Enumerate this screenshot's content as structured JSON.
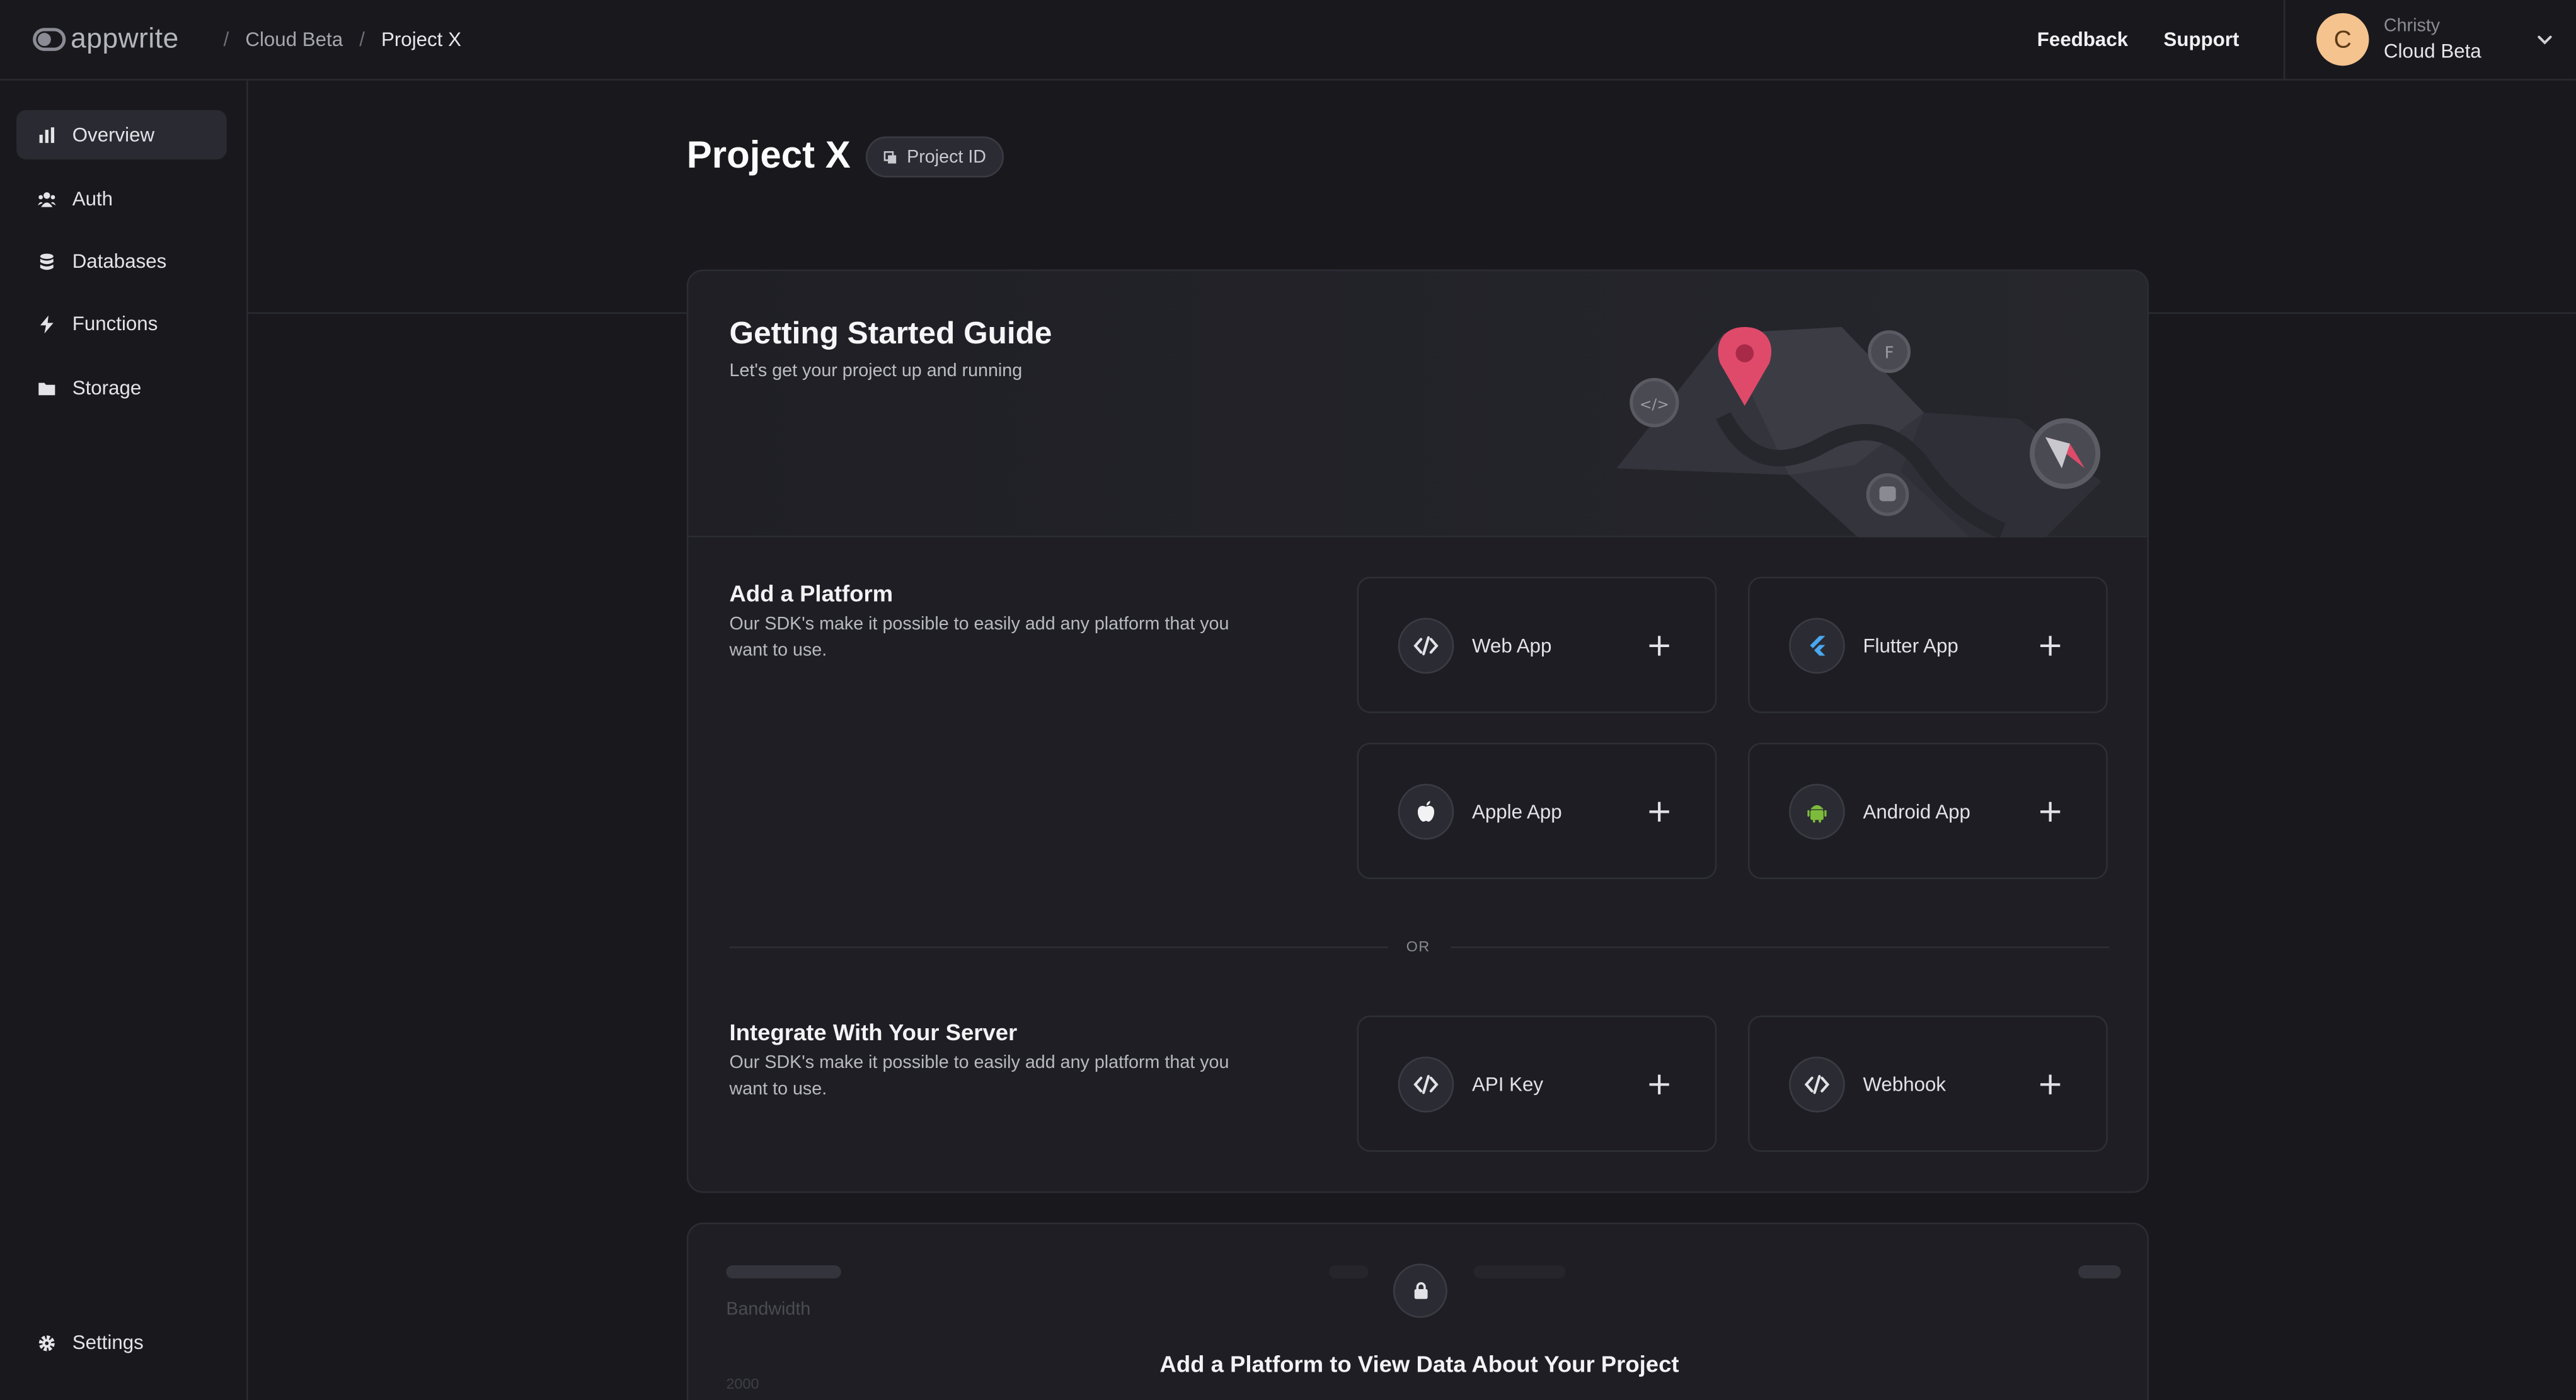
{
  "brand": {
    "name": "appwrite"
  },
  "breadcrumb": [
    "Cloud Beta",
    "Project X"
  ],
  "header": {
    "feedback_label": "Feedback",
    "support_label": "Support",
    "user": {
      "initial": "C",
      "name": "Christy",
      "org": "Cloud Beta"
    }
  },
  "sidebar": {
    "items": [
      {
        "label": "Overview",
        "icon": "bar-chart-icon",
        "active": true
      },
      {
        "label": "Auth",
        "icon": "users-icon"
      },
      {
        "label": "Databases",
        "icon": "database-icon"
      },
      {
        "label": "Functions",
        "icon": "lightning-icon"
      },
      {
        "label": "Storage",
        "icon": "folder-icon"
      }
    ],
    "settings_label": "Settings"
  },
  "page": {
    "title": "Project X",
    "project_id_label": "Project ID"
  },
  "guide": {
    "title": "Getting Started Guide",
    "subtitle": "Let's get your project up and running",
    "platform": {
      "title": "Add a Platform",
      "desc": "Our SDK's make it possible to easily add any platform that you want to use.",
      "tiles": [
        {
          "label": "Web App",
          "icon": "code-icon"
        },
        {
          "label": "Flutter App",
          "icon": "flutter-icon"
        },
        {
          "label": "Apple App",
          "icon": "apple-icon"
        },
        {
          "label": "Android App",
          "icon": "android-icon"
        }
      ]
    },
    "or_label": "OR",
    "server": {
      "title": "Integrate With Your Server",
      "desc": "Our SDK's make it possible to easily add any platform that you want to use.",
      "tiles": [
        {
          "label": "API Key",
          "icon": "code-icon"
        },
        {
          "label": "Webhook",
          "icon": "code-icon"
        }
      ]
    }
  },
  "usage": {
    "metric_label": "Bandwidth",
    "axis_value": "2000",
    "cta": "Add a Platform to View Data About Your Project"
  },
  "colors": {
    "background": "#19191d",
    "card": "#1e1e24",
    "accent_pin": "#e04a6a",
    "avatar": "#f5c38e",
    "flutter": "#4aa8f0",
    "android": "#7dbb3c"
  }
}
